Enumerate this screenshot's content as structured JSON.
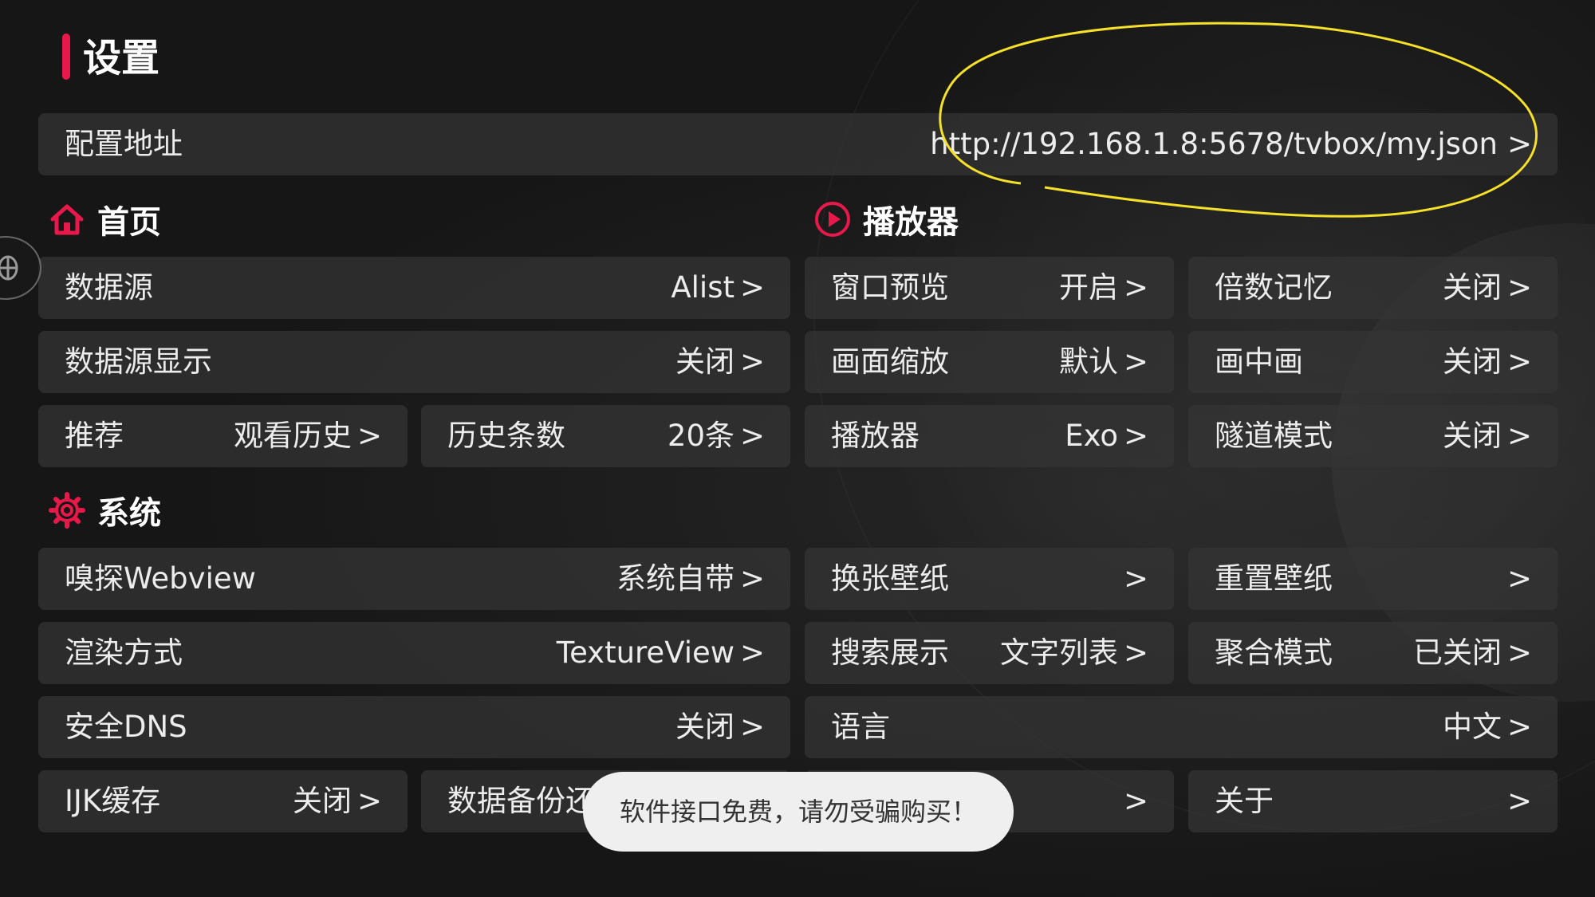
{
  "page_title": "设置",
  "colors": {
    "accent": "#e8194a",
    "highlight": "#f5e02a",
    "tile_bg": "#343434"
  },
  "config": {
    "label": "配置地址",
    "value": "http://192.168.1.8:5678/tvbox/my.json",
    "arrow": ">"
  },
  "sections": {
    "home": {
      "title": "首页",
      "icon": "home-icon"
    },
    "player": {
      "title": "播放器",
      "icon": "play-circle-icon"
    },
    "system": {
      "title": "系统",
      "icon": "gear-icon"
    }
  },
  "home": {
    "data_source": {
      "label": "数据源",
      "value": "Alist",
      "arrow": ">"
    },
    "data_source_display": {
      "label": "数据源显示",
      "value": "关闭",
      "arrow": ">"
    },
    "recommend": {
      "label": "推荐",
      "value": "观看历史",
      "arrow": ">"
    },
    "history_count": {
      "label": "历史条数",
      "value": "20条",
      "arrow": ">"
    }
  },
  "player": {
    "window_preview": {
      "label": "窗口预览",
      "value": "开启",
      "arrow": ">"
    },
    "speed_memory": {
      "label": "倍数记忆",
      "value": "关闭",
      "arrow": ">"
    },
    "scaling": {
      "label": "画面缩放",
      "value": "默认",
      "arrow": ">"
    },
    "pip": {
      "label": "画中画",
      "value": "关闭",
      "arrow": ">"
    },
    "player_type": {
      "label": "播放器",
      "value": "Exo",
      "arrow": ">"
    },
    "tunnel_mode": {
      "label": "隧道模式",
      "value": "关闭",
      "arrow": ">"
    }
  },
  "system": {
    "sniff_webview": {
      "label": "嗅探Webview",
      "value": "系统自带",
      "arrow": ">"
    },
    "render_mode": {
      "label": "渲染方式",
      "value": "TextureView",
      "arrow": ">"
    },
    "secure_dns": {
      "label": "安全DNS",
      "value": "关闭",
      "arrow": ">"
    },
    "ijk_cache": {
      "label": "IJK缓存",
      "value": "关闭",
      "arrow": ">"
    },
    "backup": {
      "label": "数据备份还"
    },
    "change_wallpaper": {
      "label": "换张壁纸",
      "arrow": ">"
    },
    "reset_wallpaper": {
      "label": "重置壁纸",
      "arrow": ">"
    },
    "search_display": {
      "label": "搜索展示",
      "value": "文字列表",
      "arrow": ">"
    },
    "aggregate_mode": {
      "label": "聚合模式",
      "value": "已关闭",
      "arrow": ">"
    },
    "language": {
      "label": "语言",
      "value": "中文",
      "arrow": ">"
    },
    "hidden_item": {
      "arrow": ">"
    },
    "about": {
      "label": "关于",
      "arrow": ">"
    }
  },
  "side_icon": "bug-icon",
  "toast": {
    "text": "软件接口免费，请勿受骗购买！"
  }
}
